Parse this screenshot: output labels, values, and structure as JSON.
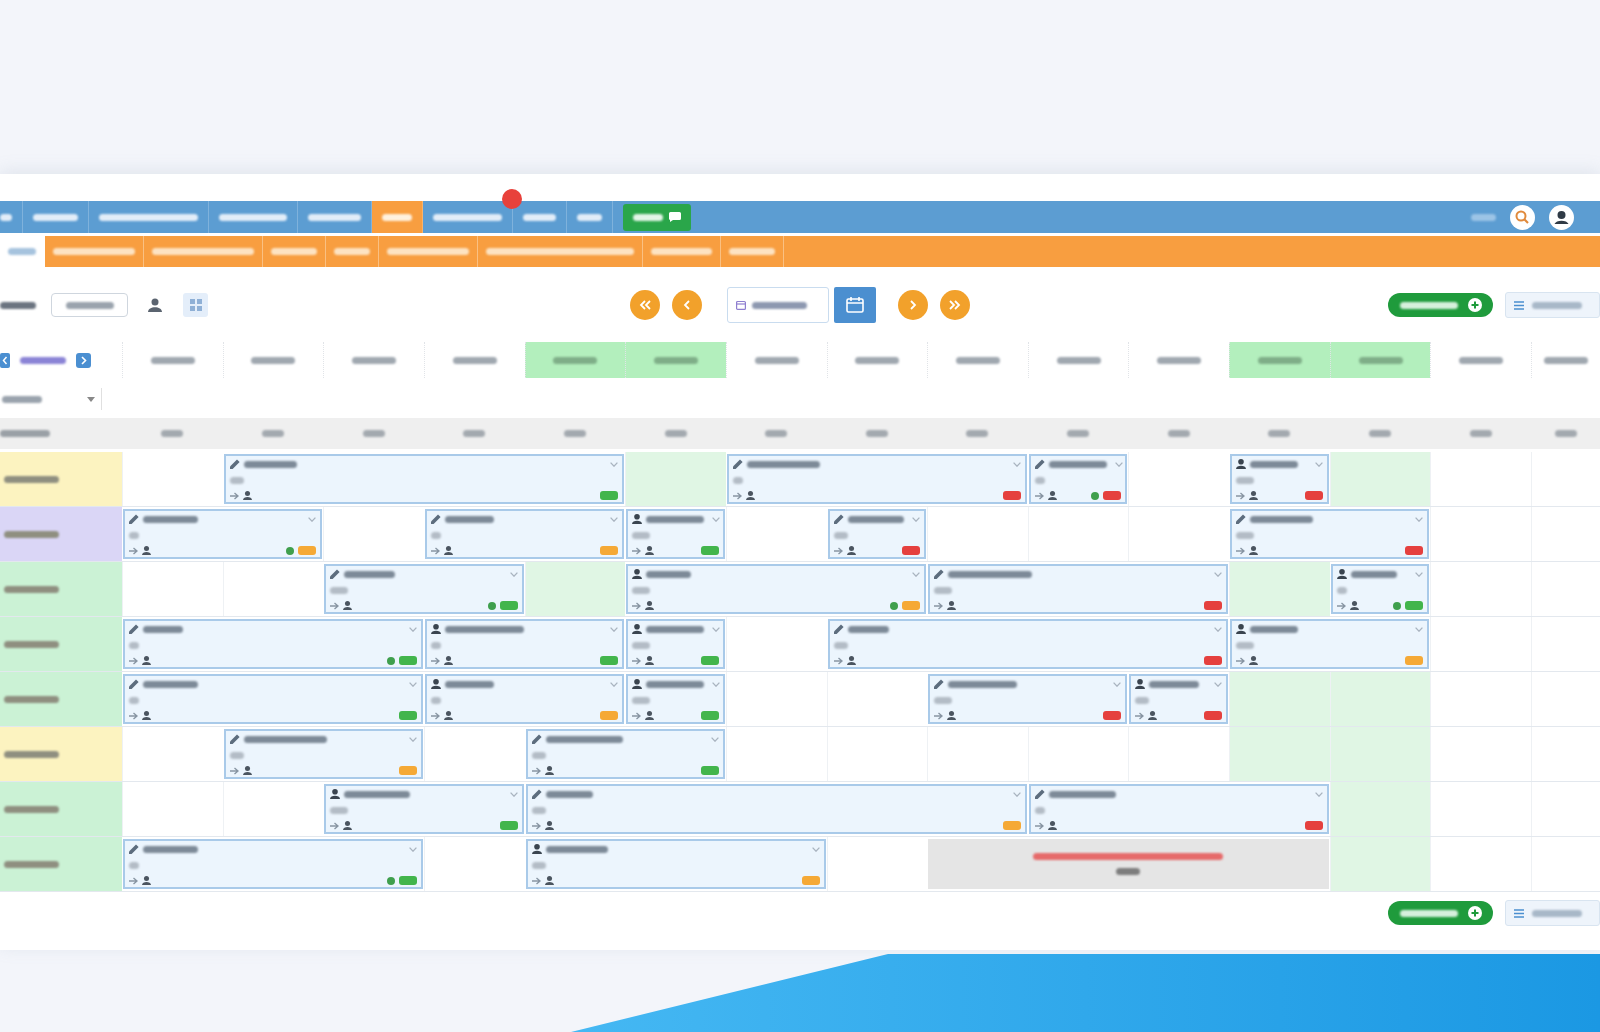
{
  "nav_bar": {
    "items": [
      {
        "selected": false,
        "badge": false
      },
      {
        "selected": false,
        "badge": false
      },
      {
        "selected": false,
        "badge": false
      },
      {
        "selected": false,
        "badge": false
      },
      {
        "selected": false,
        "badge": false
      },
      {
        "selected": true,
        "badge": false
      },
      {
        "selected": false,
        "badge": true
      },
      {
        "selected": false,
        "badge": false
      },
      {
        "selected": false,
        "badge": false
      }
    ]
  },
  "sub_nav": {
    "items": [
      {
        "selected": true
      },
      {
        "selected": false
      },
      {
        "selected": false
      },
      {
        "selected": false
      },
      {
        "selected": false
      },
      {
        "selected": false
      },
      {
        "selected": false
      },
      {
        "selected": false
      },
      {
        "selected": false
      }
    ]
  },
  "days": [
    {
      "weekend": false
    },
    {
      "weekend": false
    },
    {
      "weekend": false
    },
    {
      "weekend": false
    },
    {
      "weekend": true
    },
    {
      "weekend": true
    },
    {
      "weekend": false
    },
    {
      "weekend": false
    },
    {
      "weekend": false
    },
    {
      "weekend": false
    },
    {
      "weekend": false
    },
    {
      "weekend": true
    },
    {
      "weekend": true
    },
    {
      "weekend": false
    },
    {
      "weekend": false
    }
  ],
  "rooms": [
    {
      "color": "#fcf3c0",
      "slots": [
        {
          "kind": "free"
        },
        {
          "kind": "booking",
          "color": "#42b54c",
          "flag": false
        },
        {
          "kind": "continued"
        },
        {
          "kind": "continued"
        },
        {
          "kind": "continued"
        },
        {
          "kind": "free"
        },
        {
          "kind": "booking",
          "color": "#e5403e",
          "flag": false
        },
        {
          "kind": "continued"
        },
        {
          "kind": "continued"
        },
        {
          "kind": "booking",
          "color": "#e5403e",
          "flag": true
        },
        {
          "kind": "free"
        },
        {
          "kind": "guest",
          "color": "#e5403e",
          "flag": false
        },
        {
          "kind": "free"
        },
        {
          "kind": "free"
        },
        {
          "kind": "free"
        }
      ]
    },
    {
      "color": "#dad6f6",
      "slots": [
        {
          "kind": "booking",
          "color": "#f5a936",
          "flag": true
        },
        {
          "kind": "continued"
        },
        {
          "kind": "free"
        },
        {
          "kind": "booking",
          "color": "#f5a936",
          "flag": false
        },
        {
          "kind": "continued"
        },
        {
          "kind": "guest",
          "color": "#42b54c",
          "flag": false
        },
        {
          "kind": "free"
        },
        {
          "kind": "booking",
          "color": "#e5403e",
          "flag": false
        },
        {
          "kind": "free"
        },
        {
          "kind": "free"
        },
        {
          "kind": "free"
        },
        {
          "kind": "booking",
          "color": "#e5403e",
          "flag": false
        },
        {
          "kind": "continued"
        },
        {
          "kind": "free"
        },
        {
          "kind": "free"
        }
      ]
    },
    {
      "color": "#cbf2d5",
      "slots": [
        {
          "kind": "free"
        },
        {
          "kind": "free"
        },
        {
          "kind": "booking",
          "color": "#42b54c",
          "flag": true
        },
        {
          "kind": "continued"
        },
        {
          "kind": "free"
        },
        {
          "kind": "guest",
          "color": "#f5a936",
          "flag": true
        },
        {
          "kind": "continued"
        },
        {
          "kind": "continued"
        },
        {
          "kind": "booking",
          "color": "#e5403e",
          "flag": false
        },
        {
          "kind": "continued"
        },
        {
          "kind": "continued"
        },
        {
          "kind": "free"
        },
        {
          "kind": "guest",
          "color": "#42b54c",
          "flag": true
        },
        {
          "kind": "free"
        },
        {
          "kind": "free"
        }
      ]
    },
    {
      "color": "#cbf2d5",
      "slots": [
        {
          "kind": "booking",
          "color": "#42b54c",
          "flag": true
        },
        {
          "kind": "continued"
        },
        {
          "kind": "continued"
        },
        {
          "kind": "guest",
          "color": "#42b54c",
          "flag": false
        },
        {
          "kind": "continued"
        },
        {
          "kind": "guest",
          "color": "#42b54c",
          "flag": false
        },
        {
          "kind": "free"
        },
        {
          "kind": "booking",
          "color": "#e5403e",
          "flag": false
        },
        {
          "kind": "continued"
        },
        {
          "kind": "continued"
        },
        {
          "kind": "continued"
        },
        {
          "kind": "guest",
          "color": "#f5a936",
          "flag": false
        },
        {
          "kind": "continued"
        },
        {
          "kind": "free"
        },
        {
          "kind": "free"
        }
      ]
    },
    {
      "color": "#cbf2d5",
      "slots": [
        {
          "kind": "booking",
          "color": "#42b54c",
          "flag": false
        },
        {
          "kind": "continued"
        },
        {
          "kind": "continued"
        },
        {
          "kind": "guest",
          "color": "#f5a936",
          "flag": false
        },
        {
          "kind": "continued"
        },
        {
          "kind": "guest",
          "color": "#42b54c",
          "flag": false
        },
        {
          "kind": "free"
        },
        {
          "kind": "free"
        },
        {
          "kind": "booking",
          "color": "#e5403e",
          "flag": false
        },
        {
          "kind": "continued"
        },
        {
          "kind": "guest",
          "color": "#e5403e",
          "flag": false
        },
        {
          "kind": "free"
        },
        {
          "kind": "free"
        },
        {
          "kind": "free"
        },
        {
          "kind": "free"
        }
      ]
    },
    {
      "color": "#fcf3c0",
      "slots": [
        {
          "kind": "free"
        },
        {
          "kind": "booking",
          "color": "#f5a936",
          "flag": false
        },
        {
          "kind": "continued"
        },
        {
          "kind": "free"
        },
        {
          "kind": "booking",
          "color": "#42b54c",
          "flag": false
        },
        {
          "kind": "continued"
        },
        {
          "kind": "free"
        },
        {
          "kind": "free"
        },
        {
          "kind": "free"
        },
        {
          "kind": "free"
        },
        {
          "kind": "free"
        },
        {
          "kind": "free"
        },
        {
          "kind": "free"
        },
        {
          "kind": "free"
        },
        {
          "kind": "free"
        }
      ]
    },
    {
      "color": "#cbf2d5",
      "slots": [
        {
          "kind": "free"
        },
        {
          "kind": "free"
        },
        {
          "kind": "guest",
          "color": "#42b54c",
          "flag": false
        },
        {
          "kind": "continued"
        },
        {
          "kind": "booking",
          "color": "#f5a936",
          "flag": false
        },
        {
          "kind": "continued"
        },
        {
          "kind": "continued"
        },
        {
          "kind": "continued"
        },
        {
          "kind": "continued"
        },
        {
          "kind": "booking",
          "color": "#e5403e",
          "flag": false
        },
        {
          "kind": "continued"
        },
        {
          "kind": "continued"
        },
        {
          "kind": "free"
        },
        {
          "kind": "free"
        },
        {
          "kind": "free"
        }
      ]
    },
    {
      "color": "#cbf2d5",
      "slots": [
        {
          "kind": "booking",
          "color": "#42b54c",
          "flag": true
        },
        {
          "kind": "continued"
        },
        {
          "kind": "continued"
        },
        {
          "kind": "free"
        },
        {
          "kind": "guest",
          "color": "#f5a936",
          "flag": false
        },
        {
          "kind": "continued"
        },
        {
          "kind": "continued"
        },
        {
          "kind": "free"
        },
        {
          "kind": "blocked"
        },
        {
          "kind": "continued"
        },
        {
          "kind": "continued"
        },
        {
          "kind": "continued"
        },
        {
          "kind": "free"
        },
        {
          "kind": "free"
        },
        {
          "kind": "free"
        }
      ]
    }
  ]
}
